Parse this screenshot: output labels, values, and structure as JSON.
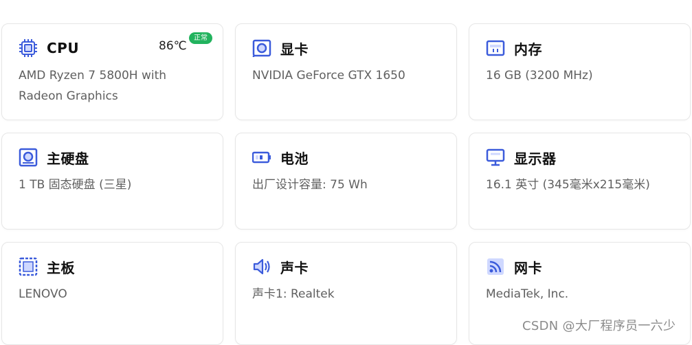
{
  "accent_color": "#3b5bdb",
  "status_color": "#22b35e",
  "cards": [
    {
      "title": "CPU",
      "icon": "cpu-icon",
      "value": "AMD Ryzen 7 5800H with Radeon Graphics",
      "temperature": "86℃",
      "status": "正常"
    },
    {
      "title": "显卡",
      "icon": "graphics-card-icon",
      "value": "NVIDIA GeForce GTX 1650"
    },
    {
      "title": "内存",
      "icon": "memory-icon",
      "value": "16 GB (3200 MHz)"
    },
    {
      "title": "主硬盘",
      "icon": "hard-disk-icon",
      "value": "1 TB 固态硬盘 (三星)"
    },
    {
      "title": "电池",
      "icon": "battery-icon",
      "value": "出厂设计容量: 75 Wh"
    },
    {
      "title": "显示器",
      "icon": "monitor-icon",
      "value": "16.1 英寸 (345毫米x215毫米)"
    },
    {
      "title": "主板",
      "icon": "motherboard-icon",
      "value": "LENOVO"
    },
    {
      "title": "声卡",
      "icon": "speaker-icon",
      "value": "声卡1: Realtek"
    },
    {
      "title": "网卡",
      "icon": "network-icon",
      "value": "MediaTek, Inc."
    }
  ],
  "watermark": "CSDN @大厂程序员一六少"
}
